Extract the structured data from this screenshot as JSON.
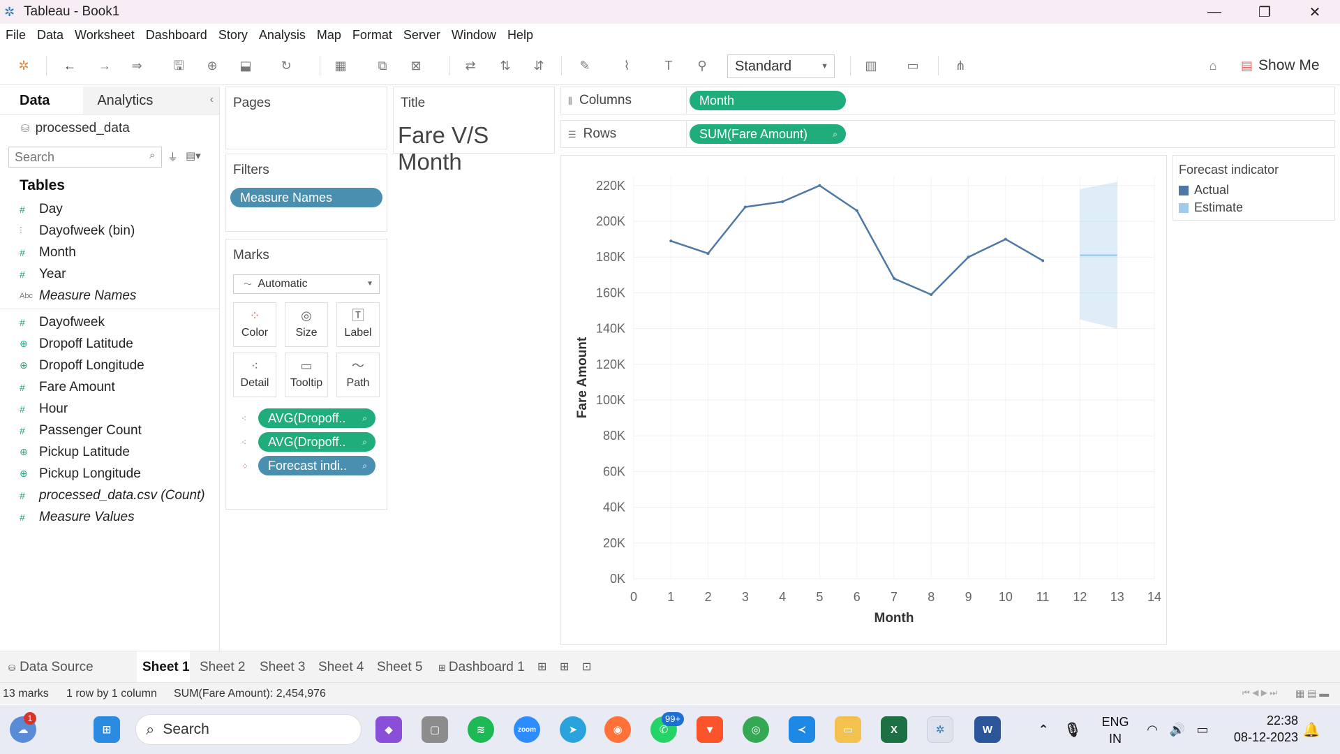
{
  "window": {
    "title": "Tableau - Book1"
  },
  "menu": [
    "File",
    "Data",
    "Worksheet",
    "Dashboard",
    "Story",
    "Analysis",
    "Map",
    "Format",
    "Server",
    "Window",
    "Help"
  ],
  "toolbar": {
    "fit_select": "Standard",
    "show_me": "Show Me"
  },
  "data_panel": {
    "tab_data": "Data",
    "tab_analytics": "Analytics",
    "datasource": "processed_data",
    "search_placeholder": "Search",
    "tables_heading": "Tables",
    "dimension_fields": [
      {
        "label": "Day",
        "icon": "#"
      },
      {
        "label": "Dayofweek (bin)",
        "icon": "bin"
      },
      {
        "label": "Month",
        "icon": "#"
      },
      {
        "label": "Year",
        "icon": "#"
      },
      {
        "label": "Measure Names",
        "icon": "Abc",
        "italic": true
      }
    ],
    "measure_fields": [
      {
        "label": "Dayofweek",
        "icon": "#"
      },
      {
        "label": "Dropoff Latitude",
        "icon": "geo"
      },
      {
        "label": "Dropoff Longitude",
        "icon": "geo"
      },
      {
        "label": "Fare Amount",
        "icon": "#"
      },
      {
        "label": "Hour",
        "icon": "#"
      },
      {
        "label": "Passenger Count",
        "icon": "#"
      },
      {
        "label": "Pickup Latitude",
        "icon": "geo"
      },
      {
        "label": "Pickup Longitude",
        "icon": "geo"
      },
      {
        "label": "processed_data.csv (Count)",
        "icon": "#",
        "italic": true
      },
      {
        "label": "Measure Values",
        "icon": "#",
        "italic": true
      }
    ]
  },
  "pages_card": {
    "title": "Pages"
  },
  "filters_card": {
    "title": "Filters",
    "pill": "Measure Names"
  },
  "marks_card": {
    "title": "Marks",
    "mark_type": "Automatic",
    "buttons": [
      "Color",
      "Size",
      "Label",
      "Detail",
      "Tooltip",
      "Path"
    ],
    "pills": [
      "AVG(Dropoff..",
      "AVG(Dropoff..",
      "Forecast indi.."
    ]
  },
  "title_card": {
    "label": "Title",
    "text": "Fare V/S Month"
  },
  "shelves": {
    "columns_label": "Columns",
    "columns_pill": "Month",
    "rows_label": "Rows",
    "rows_pill": "SUM(Fare Amount)"
  },
  "legend": {
    "title": "Forecast indicator",
    "items": [
      {
        "label": "Actual",
        "color": "#4e79a7"
      },
      {
        "label": "Estimate",
        "color": "#a0cbe8"
      }
    ]
  },
  "chart_data": {
    "type": "line",
    "xlabel": "Month",
    "ylabel": "Fare Amount",
    "xlim": [
      0,
      14
    ],
    "ylim": [
      0,
      225000
    ],
    "x_ticks": [
      "0",
      "1",
      "2",
      "3",
      "4",
      "5",
      "6",
      "7",
      "8",
      "9",
      "10",
      "11",
      "12",
      "13",
      "14"
    ],
    "y_ticks": [
      "0K",
      "20K",
      "40K",
      "60K",
      "80K",
      "100K",
      "120K",
      "140K",
      "160K",
      "180K",
      "200K",
      "220K"
    ],
    "grid": true,
    "series": [
      {
        "name": "Actual",
        "color": "#4e79a7",
        "x": [
          1,
          2,
          3,
          4,
          5,
          6,
          7,
          8,
          9,
          10,
          11
        ],
        "y": [
          189000,
          182000,
          208000,
          211000,
          220000,
          206000,
          168000,
          159000,
          180000,
          190000,
          178000
        ]
      },
      {
        "name": "Estimate",
        "color": "#a0cbe8",
        "x": [
          12,
          13
        ],
        "y": [
          181000,
          181000
        ],
        "upper": [
          218000,
          222000
        ],
        "lower": [
          145000,
          140000
        ]
      }
    ]
  },
  "sheet_tabs": {
    "data_source": "Data Source",
    "sheets": [
      "Sheet 1",
      "Sheet 2",
      "Sheet 3",
      "Sheet 4",
      "Sheet 5"
    ],
    "dashboard": "Dashboard 1",
    "active": "Sheet 1"
  },
  "status": {
    "marks": "13 marks",
    "rows_cols": "1 row by 1 column",
    "sum": "SUM(Fare Amount): 2,454,976"
  },
  "taskbar": {
    "search": "Search",
    "whatsapp_badge": "99+",
    "lang_top": "ENG",
    "lang_bottom": "IN",
    "time": "22:38",
    "date": "08-12-2023",
    "weather_badge": "1"
  }
}
